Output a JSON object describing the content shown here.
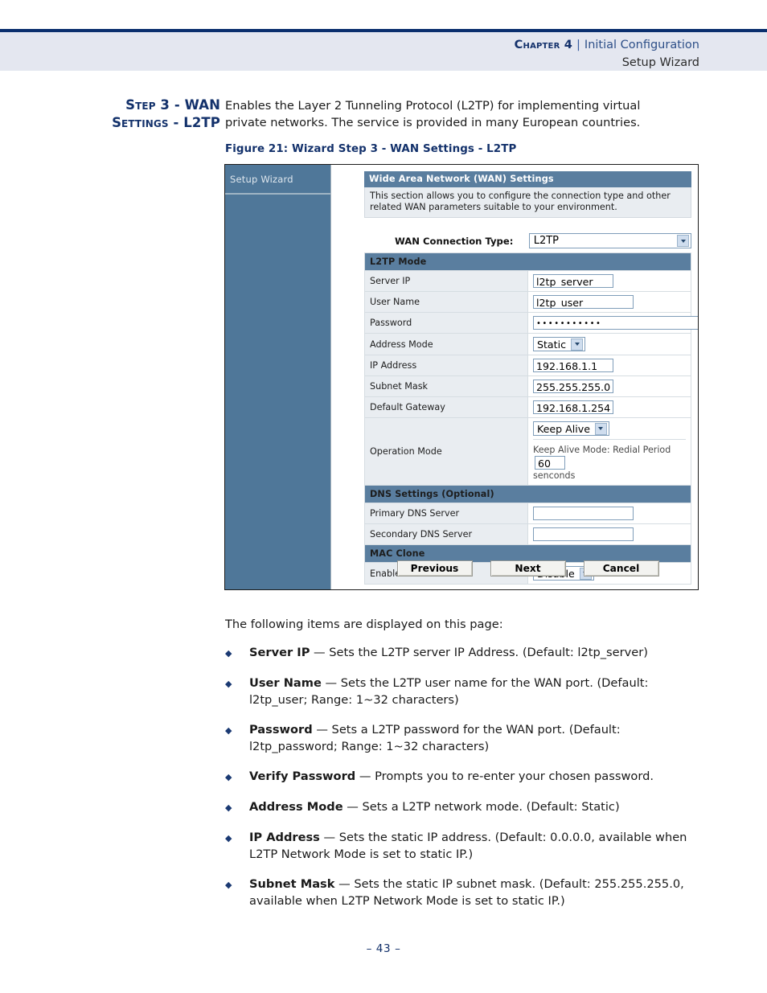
{
  "header": {
    "chapter_label": "Chapter 4",
    "separator": "|",
    "chapter_title": "Initial Configuration",
    "subtitle": "Setup Wizard"
  },
  "step": {
    "heading_line1": "Step 3 - WAN",
    "heading_line2": "Settings - L2TP",
    "intro": "Enables the Layer 2 Tunneling Protocol (L2TP) for implementing virtual private networks. The service is provided in many European countries."
  },
  "figure": {
    "caption": "Figure 21:  Wizard Step 3 - WAN Settings - L2TP",
    "sidebar": {
      "nav_item": "Setup Wizard"
    },
    "wan": {
      "section_title": "Wide Area Network (WAN) Settings",
      "description": "This section allows you to configure the connection type and other related WAN parameters suitable to your environment.",
      "connection_type_label": "WAN Connection Type:",
      "connection_type_value": "L2TP"
    },
    "l2tp": {
      "section_title": "L2TP Mode",
      "rows": [
        {
          "label": "Server IP",
          "value": "l2tp_server"
        },
        {
          "label": "User Name",
          "value": "l2tp_user"
        },
        {
          "label": "Password",
          "value": "•••••••••••"
        },
        {
          "label": "Address Mode",
          "value": "Static"
        },
        {
          "label": "IP Address",
          "value": "192.168.1.1"
        },
        {
          "label": "Subnet Mask",
          "value": "255.255.255.0"
        },
        {
          "label": "Default Gateway",
          "value": "192.168.1.254"
        }
      ],
      "operation_mode": {
        "label": "Operation Mode",
        "select_value": "Keep Alive",
        "note_prefix": "Keep Alive Mode: Redial Period",
        "redial_period": "60",
        "note_suffix": "senconds"
      }
    },
    "dns": {
      "section_title": "DNS Settings (Optional)",
      "rows": [
        {
          "label": "Primary DNS Server",
          "value": ""
        },
        {
          "label": "Secondary DNS Server",
          "value": ""
        }
      ]
    },
    "mac_clone": {
      "section_title": "MAC Clone",
      "label": "Enabled",
      "value": "Disable"
    },
    "buttons": {
      "previous": "Previous",
      "next": "Next",
      "cancel": "Cancel"
    }
  },
  "body": {
    "lead": "The following items are displayed on this page:",
    "bullets": [
      {
        "term": "Server IP",
        "rest": " — Sets the L2TP server IP Address. (Default: l2tp_server)"
      },
      {
        "term": "User Name",
        "rest": " — Sets the L2TP user name for the WAN port. (Default: l2tp_user; Range: 1~32 characters)"
      },
      {
        "term": "Password",
        "rest": " — Sets a L2TP password for the WAN port. (Default: l2tp_password; Range: 1~32 characters)"
      },
      {
        "term": "Verify Password",
        "rest": " — Prompts you to re-enter your chosen password."
      },
      {
        "term": "Address Mode",
        "rest": " — Sets a L2TP network mode. (Default: Static)"
      },
      {
        "term": "IP Address",
        "rest": " — Sets the static IP address. (Default: 0.0.0.0, available when L2TP Network Mode is set to static IP.)"
      },
      {
        "term": "Subnet Mask",
        "rest": " — Sets the static IP subnet mask. (Default: 255.255.255.0, available when L2TP Network Mode is set to static IP.)"
      }
    ],
    "bullet_glyph": "◆"
  },
  "footer": {
    "page_number": "– 43 –"
  },
  "colors": {
    "rule_navy": "#0a2f6e",
    "header_band": "#e4e7f0",
    "heading_navy": "#13316b",
    "shot_sidebar": "#4f7799",
    "shot_section_bar": "#5a7e9f",
    "shot_label_cell": "#e9edf1"
  }
}
